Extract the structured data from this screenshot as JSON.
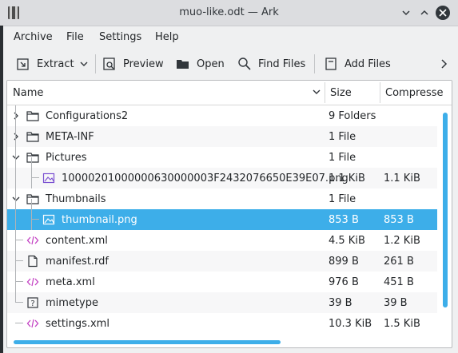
{
  "window": {
    "title": "muo-like.odt — Ark",
    "colors": {
      "accent": "#3daee9",
      "selected_text": "#ffffff",
      "text": "#232629"
    }
  },
  "menu": [
    "Archive",
    "File",
    "Settings",
    "Help"
  ],
  "toolbar": {
    "extract": "Extract",
    "preview": "Preview",
    "open": "Open",
    "find": "Find Files",
    "add": "Add Files"
  },
  "columns": {
    "name": "Name",
    "size": "Size",
    "compressed": "Compresse"
  },
  "rows": [
    {
      "name": "Configurations2",
      "size": "9 Folders",
      "compressed": "",
      "icon": "folder-icon",
      "expander": "right"
    },
    {
      "name": "META-INF",
      "size": "1 File",
      "compressed": "",
      "icon": "folder-icon",
      "expander": "right"
    },
    {
      "name": "Pictures",
      "size": "1 File",
      "compressed": "",
      "icon": "folder-icon",
      "expander": "down"
    },
    {
      "name": "10000201000000630000003F2432076650E39E07.png",
      "size": "1.1 KiB",
      "compressed": "1.1 KiB",
      "icon": "image-icon",
      "expander": ""
    },
    {
      "name": "Thumbnails",
      "size": "1 File",
      "compressed": "",
      "icon": "folder-icon",
      "expander": "down"
    },
    {
      "name": "thumbnail.png",
      "size": "853 B",
      "compressed": "853 B",
      "icon": "image-icon",
      "expander": "",
      "selected": true
    },
    {
      "name": "content.xml",
      "size": "4.5 KiB",
      "compressed": "1.2 KiB",
      "icon": "xml-icon",
      "expander": ""
    },
    {
      "name": "manifest.rdf",
      "size": "899 B",
      "compressed": "261 B",
      "icon": "file-icon",
      "expander": ""
    },
    {
      "name": "meta.xml",
      "size": "976 B",
      "compressed": "451 B",
      "icon": "xml-icon",
      "expander": ""
    },
    {
      "name": "mimetype",
      "size": "39 B",
      "compressed": "39 B",
      "icon": "unknown-file-icon",
      "expander": ""
    },
    {
      "name": "settings.xml",
      "size": "10.3 KiB",
      "compressed": "1.5 KiB",
      "icon": "xml-icon",
      "expander": ""
    }
  ]
}
